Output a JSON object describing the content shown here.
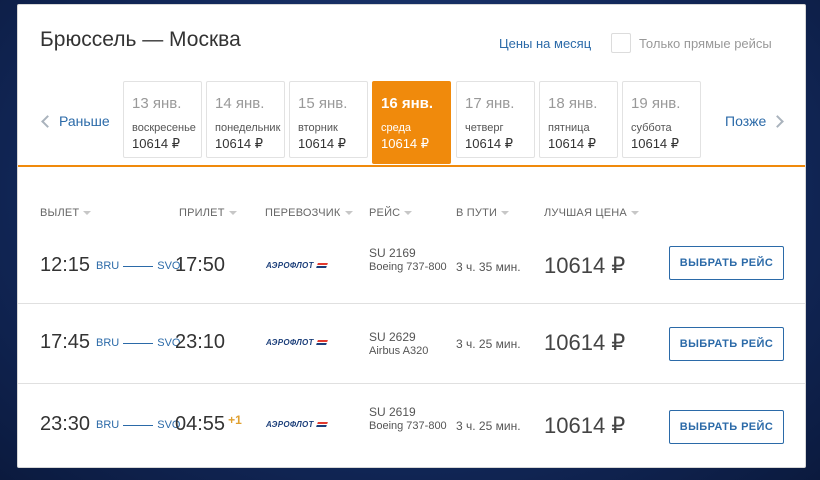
{
  "header": {
    "title": "Брюссель — Москва",
    "month_prices_link": "Цены на месяц",
    "direct_only_label": "Только прямые рейсы",
    "direct_only_checked": false
  },
  "date_nav": {
    "prev_label": "Раньше",
    "next_label": "Позже",
    "days": [
      {
        "date": "13 янв.",
        "weekday": "воскресенье",
        "price": "10614 ₽",
        "active": false
      },
      {
        "date": "14 янв.",
        "weekday": "понедельник",
        "price": "10614 ₽",
        "active": false
      },
      {
        "date": "15 янв.",
        "weekday": "вторник",
        "price": "10614 ₽",
        "active": false
      },
      {
        "date": "16 янв.",
        "weekday": "среда",
        "price": "10614 ₽",
        "active": true
      },
      {
        "date": "17 янв.",
        "weekday": "четверг",
        "price": "10614 ₽",
        "active": false
      },
      {
        "date": "18 янв.",
        "weekday": "пятница",
        "price": "10614 ₽",
        "active": false
      },
      {
        "date": "19 янв.",
        "weekday": "суббота",
        "price": "10614 ₽",
        "active": false
      }
    ]
  },
  "columns": {
    "departure": "ВЫЛЕТ",
    "arrival": "ПРИЛЕТ",
    "carrier": "ПЕРЕВОЗЧИК",
    "flight": "РЕЙС",
    "duration": "В ПУТИ",
    "best_price": "ЛУЧШАЯ ЦЕНА"
  },
  "flights": [
    {
      "dep_time": "12:15",
      "from": "BRU",
      "to": "SVO",
      "arr_time": "17:50",
      "next_day": "",
      "carrier": "АЭРОФЛОТ",
      "flight_no": "SU 2169",
      "aircraft": "Boeing 737-800",
      "duration": "3 ч. 35 мин.",
      "price": "10614 ₽",
      "button": "ВЫБРАТЬ РЕЙС"
    },
    {
      "dep_time": "17:45",
      "from": "BRU",
      "to": "SVO",
      "arr_time": "23:10",
      "next_day": "",
      "carrier": "АЭРОФЛОТ",
      "flight_no": "SU 2629",
      "aircraft": "Airbus A320",
      "duration": "3 ч. 25 мин.",
      "price": "10614 ₽",
      "button": "ВЫБРАТЬ РЕЙС"
    },
    {
      "dep_time": "23:30",
      "from": "BRU",
      "to": "SVO",
      "arr_time": "04:55",
      "next_day": "+1",
      "carrier": "АЭРОФЛОТ",
      "flight_no": "SU 2619",
      "aircraft": "Boeing 737-800",
      "duration": "3 ч. 25 мин.",
      "price": "10614 ₽",
      "button": "ВЫБРАТЬ РЕЙС"
    }
  ],
  "colors": {
    "accent": "#f08a0c",
    "link": "#2b6aa8",
    "brand_red": "#e23a2e",
    "brand_blue": "#1c3f7a"
  }
}
